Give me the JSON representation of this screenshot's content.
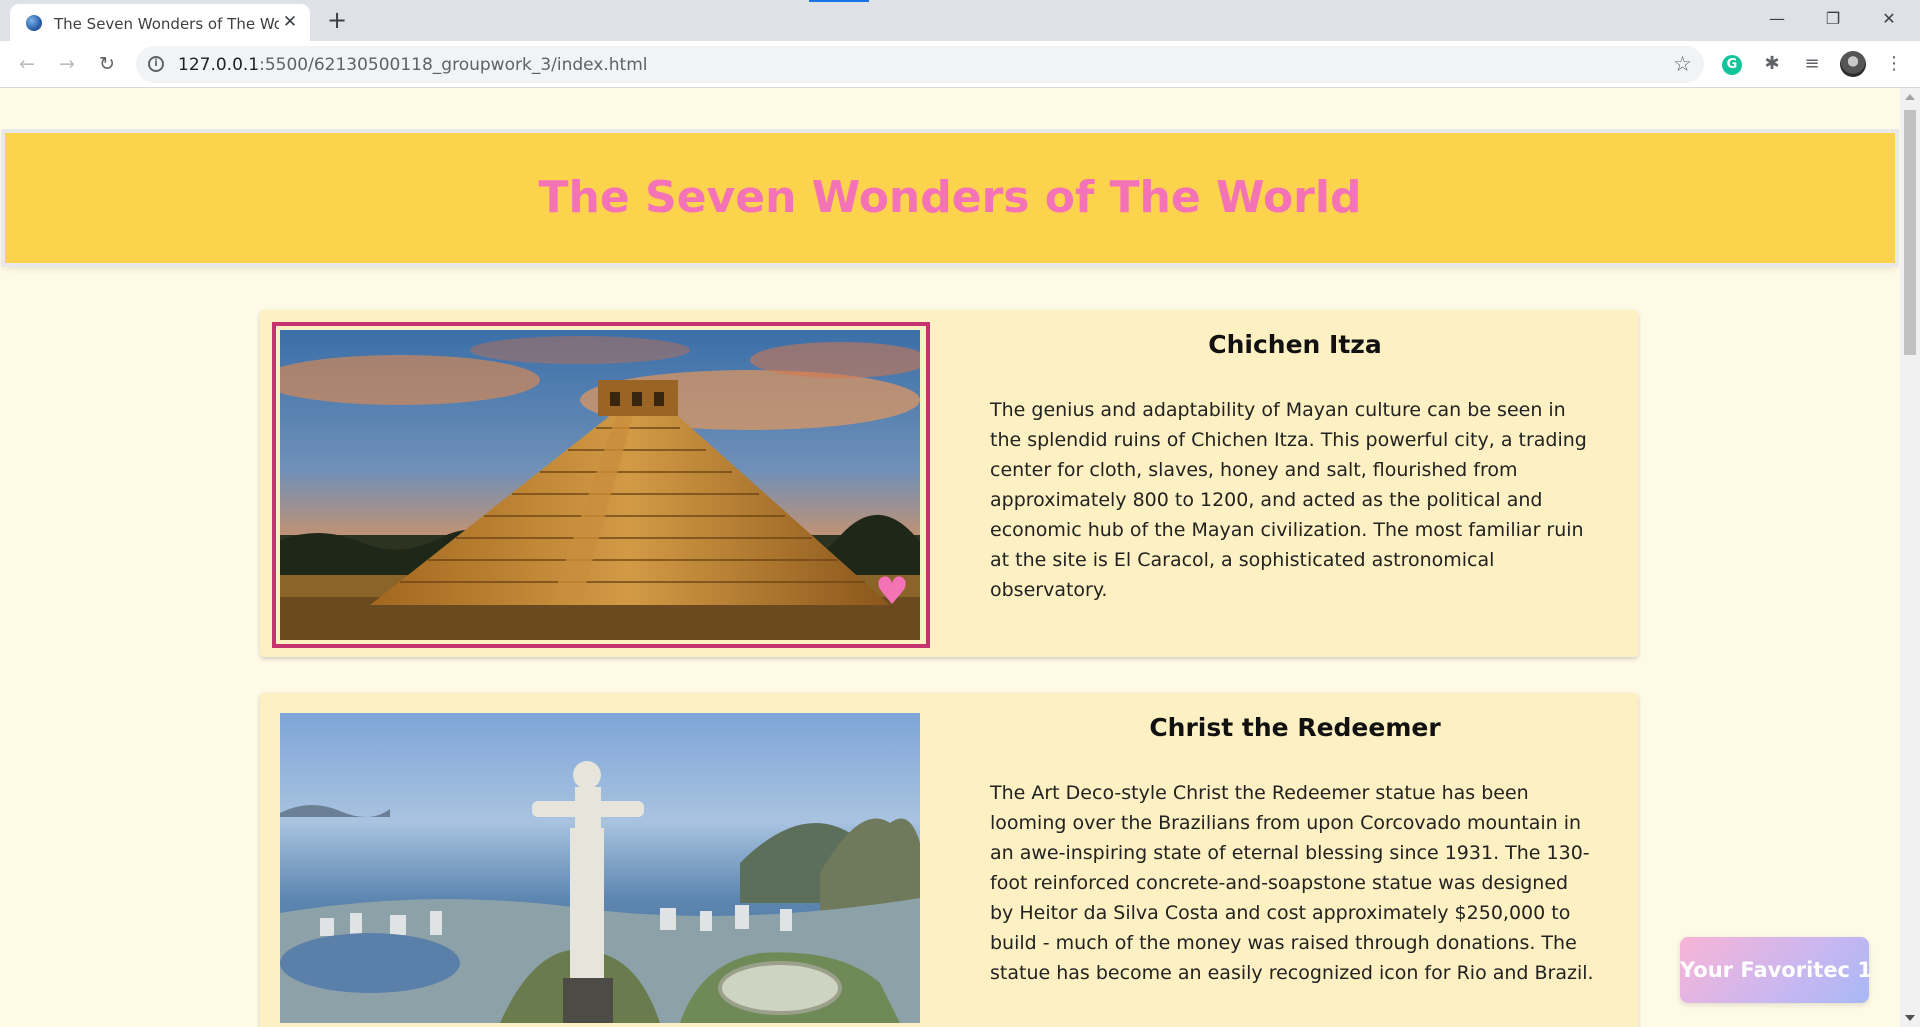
{
  "browser": {
    "tab_title": "The Seven Wonders of The World",
    "tab_close": "✕",
    "new_tab": "+",
    "url_host": "127.0.0.1",
    "url_rest": ":5500/62130500118_groupwork_3/index.html",
    "window_controls": {
      "minimize": "—",
      "restore": "❐",
      "close": "✕"
    },
    "nav": {
      "back": "←",
      "forward": "→",
      "reload": "↻"
    },
    "extensions": [
      "grammarly-icon",
      "puzzle-icon",
      "media-queue-icon",
      "profile-avatar"
    ]
  },
  "page": {
    "header_title": "The Seven Wonders of The World",
    "cards": [
      {
        "name": "Chichen Itza",
        "description": "The genius and adaptability of Mayan culture can be seen in the splendid ruins of Chichen Itza. This powerful city, a trading center for cloth, slaves, honey and salt, flourished from approximately 800 to 1200, and acted as the political and economic hub of the Mayan civilization. The most familiar ruin at the site is El Caracol, a sophisticated astronomical observatory.",
        "favorited": true
      },
      {
        "name": "Christ the Redeemer",
        "description": "The Art Deco-style Christ the Redeemer statue has been looming over the Brazilians from upon Corcovado mountain in an awe-inspiring state of eternal blessing since 1931. The 130-foot reinforced concrete-and-soapstone statue was designed by Heitor da Silva Costa and cost approximately $250,000 to build - much of the money was raised through donations. The statue has become an easily recognized icon for Rio and Brazil.",
        "favorited": false
      }
    ],
    "favorites_button": "Your Favoritec 1"
  },
  "colors": {
    "header_bg": "#fcd34d",
    "header_text": "#f472b6",
    "card_bg": "#fdf0c2",
    "page_bg": "#fefae6",
    "selected_border": "#c7336d"
  }
}
